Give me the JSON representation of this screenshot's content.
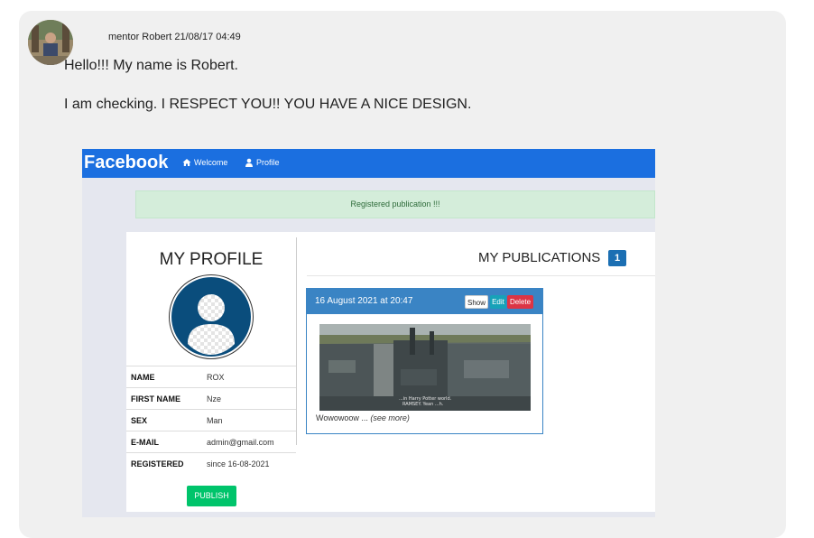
{
  "comment": {
    "author_meta": "mentor Robert 21/08/17 04:49",
    "message_line1": "Hello!!! My name is Robert.",
    "message_line2": "I am checking. I RESPECT YOU!! YOU HAVE A NICE DESIGN."
  },
  "screenshot": {
    "brand": "Facebook",
    "nav": [
      {
        "label": "Welcome",
        "icon": "home-icon"
      },
      {
        "label": "Profile",
        "icon": "user-icon"
      }
    ],
    "alert": "Registered publication !!!",
    "profile": {
      "heading": "MY PROFILE",
      "fields": [
        {
          "key": "NAME",
          "value": "ROX"
        },
        {
          "key": "FIRST NAME",
          "value": "Nze"
        },
        {
          "key": "SEX",
          "value": "Man"
        },
        {
          "key": "E-MAIL",
          "value": "admin@gmail.com"
        },
        {
          "key": "REGISTERED",
          "value": "since 16-08-2021"
        }
      ],
      "publish_label": "PUBLISH"
    },
    "publications": {
      "heading": "MY PUBLICATIONS",
      "count": "1",
      "items": [
        {
          "date": "16 August 2021 at 20:47",
          "show_label": "Show",
          "edit_label": "Edit",
          "delete_label": "Delete",
          "caption_text": "Wowowoow ...",
          "see_more": "(see more)",
          "image_caption_1": "...in Harry Potter world.",
          "image_caption_2": "RAMSEY. Yean ...h."
        }
      ]
    }
  },
  "colors": {
    "nav_bg": "#1b6fe0",
    "alert_bg": "#d4edda",
    "publish_button": "#00c46b",
    "badge": "#1b6fb3",
    "card_header": "#3a84c4",
    "edit_button": "#17a2b8",
    "delete_button": "#dc3545"
  }
}
